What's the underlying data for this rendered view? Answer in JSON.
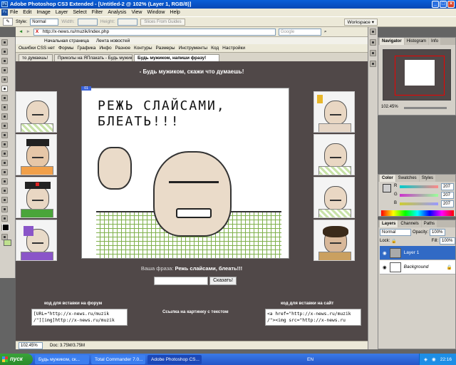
{
  "app": {
    "title": "Adobe Photoshop CS3 Extended - [Untitled-2 @ 102% (Layer 1, RGB/8)]",
    "menu": [
      "File",
      "Edit",
      "Image",
      "Layer",
      "Select",
      "Filter",
      "Analysis",
      "View",
      "Window",
      "Help"
    ],
    "options": {
      "style_label": "Style:",
      "style_value": "Normal",
      "width_label": "Width:",
      "height_label": "Height:",
      "slices_button": "Slices From Guides",
      "workspace": "Workspace ▾"
    }
  },
  "browser": {
    "url": "http://x-news.ru/muzik/index.php",
    "bookmarks": [
      "Начальная страница",
      "Лента новостей"
    ],
    "toolbar": [
      "Ошибки CSS нет",
      "Формы",
      "Графика",
      "Инфо",
      "Разное",
      "Контуры",
      "Размеры",
      "Инструменты",
      "Код",
      "Настройки"
    ],
    "tabs": [
      {
        "label": "то думаешь!",
        "active": false
      },
      {
        "label": "Приколы на ЯПлакать - Будь мужик...",
        "active": false
      },
      {
        "label": "Будь мужиком, напиши фразу!",
        "active": true
      }
    ],
    "search_placeholder": "Google"
  },
  "page": {
    "heading": "- Будь мужиком, скажи что думаешь!",
    "main_caption": "РЕЖЬ СЛАЙСАМИ, БЛЕАТЬ!!!",
    "phrase_label": "Ваша фраза:",
    "phrase_value": "Режь слайсами, блеать!!!",
    "submit": "Сказать!",
    "forum_label": "код для вставки на форум",
    "link_label": "Ссылка на картинку с текстом",
    "site_label": "код для вставки на сайт",
    "forum_code": "[URL=\"http://x-news.ru/muzik\n/\"][img]http://x-news.ru/muzik",
    "site_code": "<a href=\"http://x-news.ru/muzik\n/\"><img src=\"http://x-news.ru"
  },
  "status": {
    "zoom": "102.45%",
    "doc": "Doc: 3.75M/3.75M"
  },
  "panels": {
    "navigator_tabs": [
      "Navigator",
      "Histogram",
      "Info"
    ],
    "nav_zoom": "102.45%",
    "color_tabs": [
      "Color",
      "Swatches",
      "Styles"
    ],
    "rgb": [
      {
        "ch": "R",
        "val": "207"
      },
      {
        "ch": "G",
        "val": "207"
      },
      {
        "ch": "B",
        "val": "207"
      }
    ],
    "layers_tabs": [
      "Layers",
      "Channels",
      "Paths"
    ],
    "blend": "Normal",
    "opacity_label": "Opacity:",
    "opacity": "100%",
    "lock_label": "Lock:",
    "fill_label": "Fill:",
    "fill": "100%",
    "layers": [
      {
        "name": "Layer 1",
        "selected": true
      },
      {
        "name": "Background",
        "selected": false
      }
    ]
  },
  "taskbar": {
    "start": "пуск",
    "tasks": [
      {
        "label": "Будь мужиком, ск...",
        "active": false
      },
      {
        "label": "Total Commander 7.0...",
        "active": false
      },
      {
        "label": "Adobe Photoshop CS...",
        "active": true
      }
    ],
    "lang": "EN",
    "clock": "22:16"
  }
}
